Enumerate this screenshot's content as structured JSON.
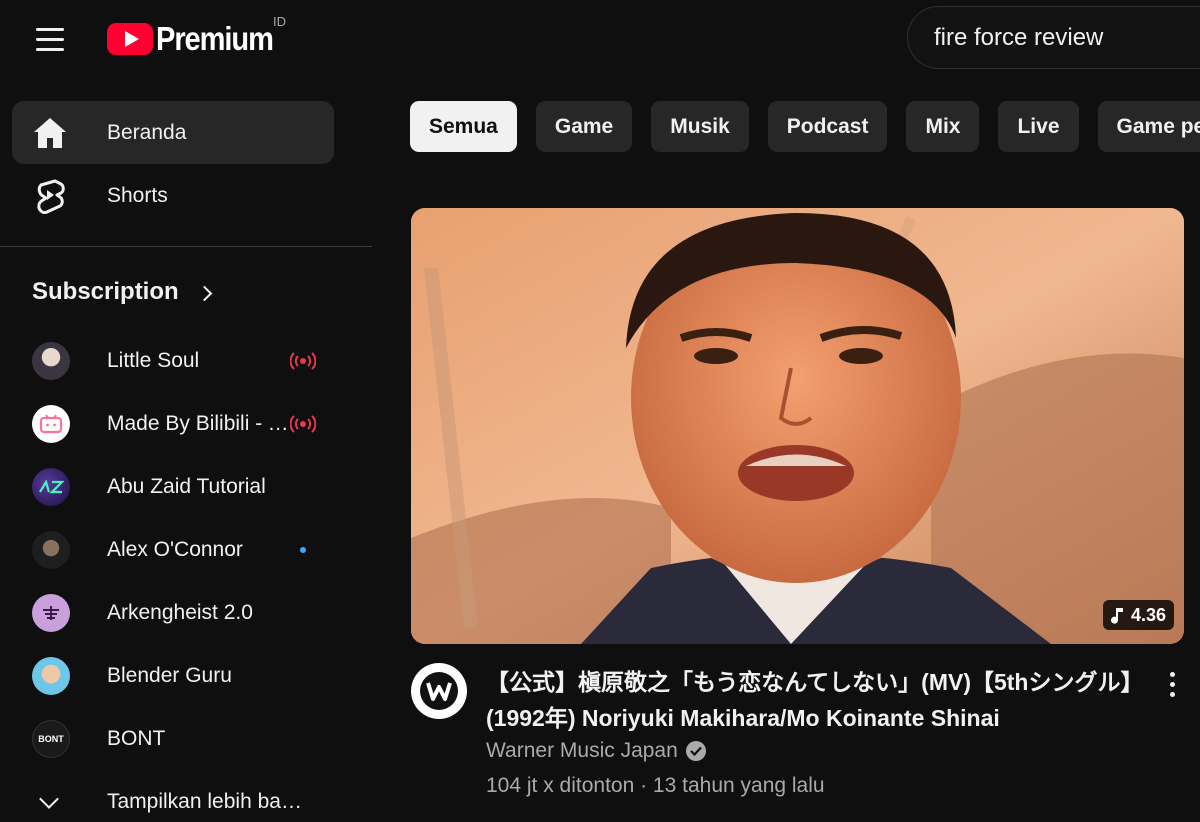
{
  "header": {
    "logo_text": "Premium",
    "region_code": "ID",
    "search_value": "fire force review"
  },
  "sidebar": {
    "main": [
      {
        "label": "Beranda",
        "icon": "home-icon",
        "active": true
      },
      {
        "label": "Shorts",
        "icon": "shorts-icon",
        "active": false
      }
    ],
    "subscription_title": "Subscription",
    "channels": [
      {
        "name": "Little Soul",
        "status": "live",
        "avatar_color": "#5a5560"
      },
      {
        "name": "Made By Bilibili - YouTube",
        "status": "live",
        "avatar_color": "#ffffff"
      },
      {
        "name": "Abu Zaid Tutorial",
        "status": "none",
        "avatar_color": "#3a2a6a"
      },
      {
        "name": "Alex O'Connor",
        "status": "new",
        "avatar_color": "#2a2a2a"
      },
      {
        "name": "Arkengheist 2.0",
        "status": "none",
        "avatar_color": "#c9a0dc"
      },
      {
        "name": "Blender Guru",
        "status": "none",
        "avatar_color": "#6ec6e8"
      },
      {
        "name": "BONT",
        "status": "none",
        "avatar_color": "#1a1a1a"
      }
    ],
    "bont_avatar_text": "BONT",
    "show_more": "Tampilkan lebih banyak"
  },
  "chips": [
    "Semua",
    "Game",
    "Musik",
    "Podcast",
    "Mix",
    "Live",
    "Game pe"
  ],
  "video": {
    "title": "【公式】槇原敬之「もう恋なんてしない」(MV)【5thシングル】 (1992年) Noriyuki Makihara/Mo Koinante Shinai",
    "channel": "Warner Music Japan",
    "meta": "104 jt x ditonton · 13 tahun yang lalu",
    "duration": "4.36"
  },
  "colors": {
    "background": "#0f0f0f",
    "accent_red": "#ff0033",
    "live_red": "#e8374f",
    "new_dot": "#3ea6ff"
  }
}
